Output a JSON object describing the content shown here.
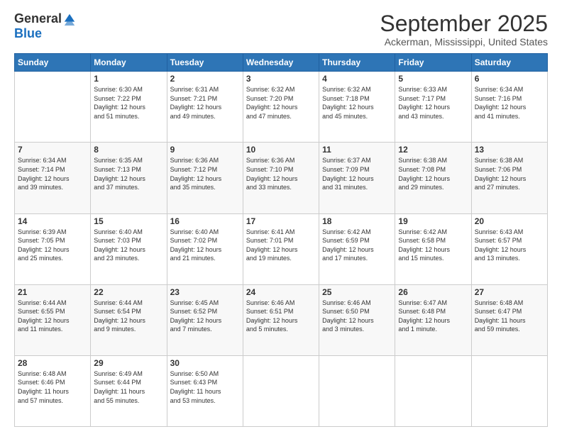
{
  "logo": {
    "general": "General",
    "blue": "Blue"
  },
  "title": "September 2025",
  "location": "Ackerman, Mississippi, United States",
  "weekdays": [
    "Sunday",
    "Monday",
    "Tuesday",
    "Wednesday",
    "Thursday",
    "Friday",
    "Saturday"
  ],
  "weeks": [
    [
      {
        "day": "",
        "info": ""
      },
      {
        "day": "1",
        "info": "Sunrise: 6:30 AM\nSunset: 7:22 PM\nDaylight: 12 hours\nand 51 minutes."
      },
      {
        "day": "2",
        "info": "Sunrise: 6:31 AM\nSunset: 7:21 PM\nDaylight: 12 hours\nand 49 minutes."
      },
      {
        "day": "3",
        "info": "Sunrise: 6:32 AM\nSunset: 7:20 PM\nDaylight: 12 hours\nand 47 minutes."
      },
      {
        "day": "4",
        "info": "Sunrise: 6:32 AM\nSunset: 7:18 PM\nDaylight: 12 hours\nand 45 minutes."
      },
      {
        "day": "5",
        "info": "Sunrise: 6:33 AM\nSunset: 7:17 PM\nDaylight: 12 hours\nand 43 minutes."
      },
      {
        "day": "6",
        "info": "Sunrise: 6:34 AM\nSunset: 7:16 PM\nDaylight: 12 hours\nand 41 minutes."
      }
    ],
    [
      {
        "day": "7",
        "info": "Sunrise: 6:34 AM\nSunset: 7:14 PM\nDaylight: 12 hours\nand 39 minutes."
      },
      {
        "day": "8",
        "info": "Sunrise: 6:35 AM\nSunset: 7:13 PM\nDaylight: 12 hours\nand 37 minutes."
      },
      {
        "day": "9",
        "info": "Sunrise: 6:36 AM\nSunset: 7:12 PM\nDaylight: 12 hours\nand 35 minutes."
      },
      {
        "day": "10",
        "info": "Sunrise: 6:36 AM\nSunset: 7:10 PM\nDaylight: 12 hours\nand 33 minutes."
      },
      {
        "day": "11",
        "info": "Sunrise: 6:37 AM\nSunset: 7:09 PM\nDaylight: 12 hours\nand 31 minutes."
      },
      {
        "day": "12",
        "info": "Sunrise: 6:38 AM\nSunset: 7:08 PM\nDaylight: 12 hours\nand 29 minutes."
      },
      {
        "day": "13",
        "info": "Sunrise: 6:38 AM\nSunset: 7:06 PM\nDaylight: 12 hours\nand 27 minutes."
      }
    ],
    [
      {
        "day": "14",
        "info": "Sunrise: 6:39 AM\nSunset: 7:05 PM\nDaylight: 12 hours\nand 25 minutes."
      },
      {
        "day": "15",
        "info": "Sunrise: 6:40 AM\nSunset: 7:03 PM\nDaylight: 12 hours\nand 23 minutes."
      },
      {
        "day": "16",
        "info": "Sunrise: 6:40 AM\nSunset: 7:02 PM\nDaylight: 12 hours\nand 21 minutes."
      },
      {
        "day": "17",
        "info": "Sunrise: 6:41 AM\nSunset: 7:01 PM\nDaylight: 12 hours\nand 19 minutes."
      },
      {
        "day": "18",
        "info": "Sunrise: 6:42 AM\nSunset: 6:59 PM\nDaylight: 12 hours\nand 17 minutes."
      },
      {
        "day": "19",
        "info": "Sunrise: 6:42 AM\nSunset: 6:58 PM\nDaylight: 12 hours\nand 15 minutes."
      },
      {
        "day": "20",
        "info": "Sunrise: 6:43 AM\nSunset: 6:57 PM\nDaylight: 12 hours\nand 13 minutes."
      }
    ],
    [
      {
        "day": "21",
        "info": "Sunrise: 6:44 AM\nSunset: 6:55 PM\nDaylight: 12 hours\nand 11 minutes."
      },
      {
        "day": "22",
        "info": "Sunrise: 6:44 AM\nSunset: 6:54 PM\nDaylight: 12 hours\nand 9 minutes."
      },
      {
        "day": "23",
        "info": "Sunrise: 6:45 AM\nSunset: 6:52 PM\nDaylight: 12 hours\nand 7 minutes."
      },
      {
        "day": "24",
        "info": "Sunrise: 6:46 AM\nSunset: 6:51 PM\nDaylight: 12 hours\nand 5 minutes."
      },
      {
        "day": "25",
        "info": "Sunrise: 6:46 AM\nSunset: 6:50 PM\nDaylight: 12 hours\nand 3 minutes."
      },
      {
        "day": "26",
        "info": "Sunrise: 6:47 AM\nSunset: 6:48 PM\nDaylight: 12 hours\nand 1 minute."
      },
      {
        "day": "27",
        "info": "Sunrise: 6:48 AM\nSunset: 6:47 PM\nDaylight: 11 hours\nand 59 minutes."
      }
    ],
    [
      {
        "day": "28",
        "info": "Sunrise: 6:48 AM\nSunset: 6:46 PM\nDaylight: 11 hours\nand 57 minutes."
      },
      {
        "day": "29",
        "info": "Sunrise: 6:49 AM\nSunset: 6:44 PM\nDaylight: 11 hours\nand 55 minutes."
      },
      {
        "day": "30",
        "info": "Sunrise: 6:50 AM\nSunset: 6:43 PM\nDaylight: 11 hours\nand 53 minutes."
      },
      {
        "day": "",
        "info": ""
      },
      {
        "day": "",
        "info": ""
      },
      {
        "day": "",
        "info": ""
      },
      {
        "day": "",
        "info": ""
      }
    ]
  ]
}
